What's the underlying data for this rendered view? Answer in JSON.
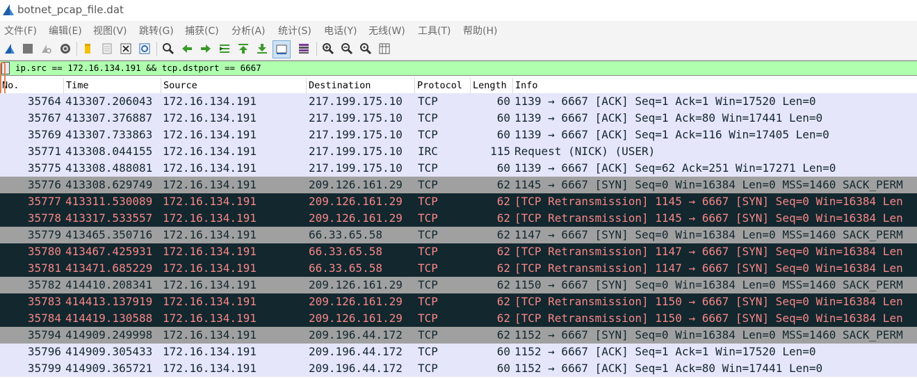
{
  "window": {
    "title": "botnet_pcap_file.dat"
  },
  "menu": [
    "文件(F)",
    "编辑(E)",
    "视图(V)",
    "跳转(G)",
    "捕获(C)",
    "分析(A)",
    "统计(S)",
    "电话(Y)",
    "无线(W)",
    "工具(T)",
    "帮助(H)"
  ],
  "toolbar": {
    "icons": [
      "shark-fin-start-icon",
      "stop-icon",
      "restart-icon",
      "options-gear-icon",
      "open-folder-icon",
      "save-icon",
      "close-file-icon",
      "reload-icon",
      "find-icon",
      "back-icon",
      "forward-icon",
      "go-to-packet-icon",
      "first-packet-icon",
      "last-packet-icon",
      "autoscroll-icon",
      "colorize-icon",
      "zoom-in-icon",
      "zoom-out-icon",
      "zoom-normal-icon",
      "resize-columns-icon"
    ]
  },
  "filter": {
    "value": "ip.src == 172.16.134.191 && tcp.dstport == 6667"
  },
  "columns": [
    "No.",
    "Time",
    "Source",
    "Destination",
    "Protocol",
    "Length",
    "Info"
  ],
  "colors": {
    "ack": "#e6e6fa",
    "syn": "#a0a0a0",
    "retrans_bg": "#12272e",
    "retrans_fg": "#f78787",
    "filter_ok": "#afffaf"
  },
  "packets": [
    {
      "no": "35764",
      "time": "413307.206043",
      "src": "172.16.134.191",
      "dst": "217.199.175.10",
      "proto": "TCP",
      "len": "60",
      "info": "1139 → 6667 [ACK] Seq=1 Ack=1 Win=17520 Len=0",
      "style": "ack"
    },
    {
      "no": "35767",
      "time": "413307.376887",
      "src": "172.16.134.191",
      "dst": "217.199.175.10",
      "proto": "TCP",
      "len": "60",
      "info": "1139 → 6667 [ACK] Seq=1 Ack=80 Win=17441 Len=0",
      "style": "ack"
    },
    {
      "no": "35769",
      "time": "413307.733863",
      "src": "172.16.134.191",
      "dst": "217.199.175.10",
      "proto": "TCP",
      "len": "60",
      "info": "1139 → 6667 [ACK] Seq=1 Ack=116 Win=17405 Len=0",
      "style": "ack"
    },
    {
      "no": "35771",
      "time": "413308.044155",
      "src": "172.16.134.191",
      "dst": "217.199.175.10",
      "proto": "IRC",
      "len": "115",
      "info": "Request (NICK) (USER)",
      "style": "ack"
    },
    {
      "no": "35775",
      "time": "413308.488081",
      "src": "172.16.134.191",
      "dst": "217.199.175.10",
      "proto": "TCP",
      "len": "60",
      "info": "1139 → 6667 [ACK] Seq=62 Ack=251 Win=17271 Len=0",
      "style": "ack"
    },
    {
      "no": "35776",
      "time": "413308.629749",
      "src": "172.16.134.191",
      "dst": "209.126.161.29",
      "proto": "TCP",
      "len": "62",
      "info": "1145 → 6667 [SYN] Seq=0 Win=16384 Len=0 MSS=1460 SACK_PERM",
      "style": "syn"
    },
    {
      "no": "35777",
      "time": "413311.530089",
      "src": "172.16.134.191",
      "dst": "209.126.161.29",
      "proto": "TCP",
      "len": "62",
      "info": "[TCP Retransmission] 1145 → 6667 [SYN] Seq=0 Win=16384 Len",
      "style": "retrans"
    },
    {
      "no": "35778",
      "time": "413317.533557",
      "src": "172.16.134.191",
      "dst": "209.126.161.29",
      "proto": "TCP",
      "len": "62",
      "info": "[TCP Retransmission] 1145 → 6667 [SYN] Seq=0 Win=16384 Len",
      "style": "retrans"
    },
    {
      "no": "35779",
      "time": "413465.350716",
      "src": "172.16.134.191",
      "dst": "66.33.65.58",
      "proto": "TCP",
      "len": "62",
      "info": "1147 → 6667 [SYN] Seq=0 Win=16384 Len=0 MSS=1460 SACK_PERM",
      "style": "syn"
    },
    {
      "no": "35780",
      "time": "413467.425931",
      "src": "172.16.134.191",
      "dst": "66.33.65.58",
      "proto": "TCP",
      "len": "62",
      "info": "[TCP Retransmission] 1147 → 6667 [SYN] Seq=0 Win=16384 Len",
      "style": "retrans"
    },
    {
      "no": "35781",
      "time": "413471.685229",
      "src": "172.16.134.191",
      "dst": "66.33.65.58",
      "proto": "TCP",
      "len": "62",
      "info": "[TCP Retransmission] 1147 → 6667 [SYN] Seq=0 Win=16384 Len",
      "style": "retrans"
    },
    {
      "no": "35782",
      "time": "414410.208341",
      "src": "172.16.134.191",
      "dst": "209.126.161.29",
      "proto": "TCP",
      "len": "62",
      "info": "1150 → 6667 [SYN] Seq=0 Win=16384 Len=0 MSS=1460 SACK_PERM",
      "style": "syn"
    },
    {
      "no": "35783",
      "time": "414413.137919",
      "src": "172.16.134.191",
      "dst": "209.126.161.29",
      "proto": "TCP",
      "len": "62",
      "info": "[TCP Retransmission] 1150 → 6667 [SYN] Seq=0 Win=16384 Len",
      "style": "retrans"
    },
    {
      "no": "35784",
      "time": "414419.130588",
      "src": "172.16.134.191",
      "dst": "209.126.161.29",
      "proto": "TCP",
      "len": "62",
      "info": "[TCP Retransmission] 1150 → 6667 [SYN] Seq=0 Win=16384 Len",
      "style": "retrans"
    },
    {
      "no": "35794",
      "time": "414909.249998",
      "src": "172.16.134.191",
      "dst": "209.196.44.172",
      "proto": "TCP",
      "len": "62",
      "info": "1152 → 6667 [SYN] Seq=0 Win=16384 Len=0 MSS=1460 SACK_PERM",
      "style": "syn"
    },
    {
      "no": "35796",
      "time": "414909.305433",
      "src": "172.16.134.191",
      "dst": "209.196.44.172",
      "proto": "TCP",
      "len": "60",
      "info": "1152 → 6667 [ACK] Seq=1 Ack=1 Win=17520 Len=0",
      "style": "ack"
    },
    {
      "no": "35799",
      "time": "414909.365721",
      "src": "172.16.134.191",
      "dst": "209.196.44.172",
      "proto": "TCP",
      "len": "60",
      "info": "1152 → 6667 [ACK] Seq=1 Ack=80 Win=17441 Len=0",
      "style": "ack"
    }
  ]
}
